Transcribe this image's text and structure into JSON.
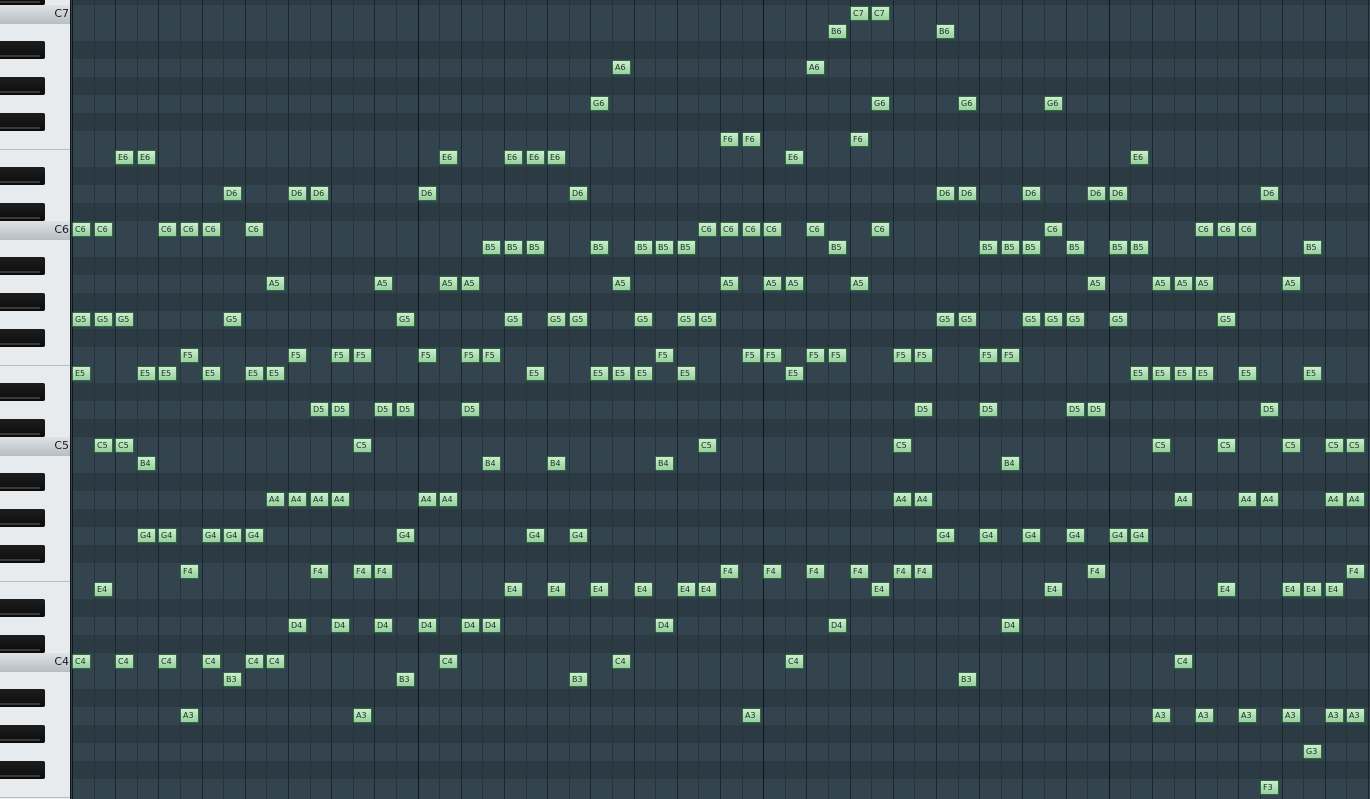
{
  "piano_roll": {
    "octave_labels": {
      "C7": "C7",
      "C6": "C6",
      "C5": "C5",
      "C4": "C4"
    },
    "note_color": "#a9dcb0",
    "grid_color": "#34444e",
    "notes": [
      {
        "pitch": "C7",
        "step": 36
      },
      {
        "pitch": "C7",
        "step": 37
      },
      {
        "pitch": "B6",
        "step": 35
      },
      {
        "pitch": "B6",
        "step": 40
      },
      {
        "pitch": "A6",
        "step": 25
      },
      {
        "pitch": "A6",
        "step": 34
      },
      {
        "pitch": "G6",
        "step": 24
      },
      {
        "pitch": "G6",
        "step": 37
      },
      {
        "pitch": "G6",
        "step": 41
      },
      {
        "pitch": "G6",
        "step": 45
      },
      {
        "pitch": "F6",
        "step": 30
      },
      {
        "pitch": "F6",
        "step": 31
      },
      {
        "pitch": "F6",
        "step": 36
      },
      {
        "pitch": "E6",
        "step": 2
      },
      {
        "pitch": "E6",
        "step": 3
      },
      {
        "pitch": "E6",
        "step": 17
      },
      {
        "pitch": "E6",
        "step": 20
      },
      {
        "pitch": "E6",
        "step": 21
      },
      {
        "pitch": "E6",
        "step": 22
      },
      {
        "pitch": "E6",
        "step": 33
      },
      {
        "pitch": "E6",
        "step": 49
      },
      {
        "pitch": "D6",
        "step": 7
      },
      {
        "pitch": "D6",
        "step": 10
      },
      {
        "pitch": "D6",
        "step": 11
      },
      {
        "pitch": "D6",
        "step": 16
      },
      {
        "pitch": "D6",
        "step": 23
      },
      {
        "pitch": "D6",
        "step": 40
      },
      {
        "pitch": "D6",
        "step": 41
      },
      {
        "pitch": "D6",
        "step": 44
      },
      {
        "pitch": "D6",
        "step": 47
      },
      {
        "pitch": "D6",
        "step": 48
      },
      {
        "pitch": "D6",
        "step": 55
      },
      {
        "pitch": "C6",
        "step": 0
      },
      {
        "pitch": "C6",
        "step": 1
      },
      {
        "pitch": "C6",
        "step": 4
      },
      {
        "pitch": "C6",
        "step": 5
      },
      {
        "pitch": "C6",
        "step": 6
      },
      {
        "pitch": "C6",
        "step": 8
      },
      {
        "pitch": "C6",
        "step": 29
      },
      {
        "pitch": "C6",
        "step": 30
      },
      {
        "pitch": "C6",
        "step": 31
      },
      {
        "pitch": "C6",
        "step": 32
      },
      {
        "pitch": "C6",
        "step": 34
      },
      {
        "pitch": "C6",
        "step": 37
      },
      {
        "pitch": "C6",
        "step": 45
      },
      {
        "pitch": "C6",
        "step": 52
      },
      {
        "pitch": "C6",
        "step": 53
      },
      {
        "pitch": "C6",
        "step": 54
      },
      {
        "pitch": "B5",
        "step": 19
      },
      {
        "pitch": "B5",
        "step": 20
      },
      {
        "pitch": "B5",
        "step": 21
      },
      {
        "pitch": "B5",
        "step": 24
      },
      {
        "pitch": "B5",
        "step": 26
      },
      {
        "pitch": "B5",
        "step": 27
      },
      {
        "pitch": "B5",
        "step": 28
      },
      {
        "pitch": "B5",
        "step": 35
      },
      {
        "pitch": "B5",
        "step": 42
      },
      {
        "pitch": "B5",
        "step": 43
      },
      {
        "pitch": "B5",
        "step": 44
      },
      {
        "pitch": "B5",
        "step": 46
      },
      {
        "pitch": "B5",
        "step": 48
      },
      {
        "pitch": "B5",
        "step": 49
      },
      {
        "pitch": "B5",
        "step": 57
      },
      {
        "pitch": "A5",
        "step": 9
      },
      {
        "pitch": "A5",
        "step": 14
      },
      {
        "pitch": "A5",
        "step": 17
      },
      {
        "pitch": "A5",
        "step": 18
      },
      {
        "pitch": "A5",
        "step": 25
      },
      {
        "pitch": "A5",
        "step": 30
      },
      {
        "pitch": "A5",
        "step": 32
      },
      {
        "pitch": "A5",
        "step": 33
      },
      {
        "pitch": "A5",
        "step": 36
      },
      {
        "pitch": "A5",
        "step": 47
      },
      {
        "pitch": "A5",
        "step": 50
      },
      {
        "pitch": "A5",
        "step": 51
      },
      {
        "pitch": "A5",
        "step": 52
      },
      {
        "pitch": "A5",
        "step": 56
      },
      {
        "pitch": "G5",
        "step": 0
      },
      {
        "pitch": "G5",
        "step": 1
      },
      {
        "pitch": "G5",
        "step": 2
      },
      {
        "pitch": "G5",
        "step": 7
      },
      {
        "pitch": "G5",
        "step": 15
      },
      {
        "pitch": "G5",
        "step": 20
      },
      {
        "pitch": "G5",
        "step": 22
      },
      {
        "pitch": "G5",
        "step": 23
      },
      {
        "pitch": "G5",
        "step": 26
      },
      {
        "pitch": "G5",
        "step": 28
      },
      {
        "pitch": "G5",
        "step": 29
      },
      {
        "pitch": "G5",
        "step": 40
      },
      {
        "pitch": "G5",
        "step": 41
      },
      {
        "pitch": "G5",
        "step": 44
      },
      {
        "pitch": "G5",
        "step": 45
      },
      {
        "pitch": "G5",
        "step": 46
      },
      {
        "pitch": "G5",
        "step": 48
      },
      {
        "pitch": "G5",
        "step": 53
      },
      {
        "pitch": "F5",
        "step": 5
      },
      {
        "pitch": "F5",
        "step": 10
      },
      {
        "pitch": "F5",
        "step": 12
      },
      {
        "pitch": "F5",
        "step": 13
      },
      {
        "pitch": "F5",
        "step": 16
      },
      {
        "pitch": "F5",
        "step": 18
      },
      {
        "pitch": "F5",
        "step": 19
      },
      {
        "pitch": "F5",
        "step": 27
      },
      {
        "pitch": "F5",
        "step": 31
      },
      {
        "pitch": "F5",
        "step": 32
      },
      {
        "pitch": "F5",
        "step": 34
      },
      {
        "pitch": "F5",
        "step": 35
      },
      {
        "pitch": "F5",
        "step": 38
      },
      {
        "pitch": "F5",
        "step": 39
      },
      {
        "pitch": "F5",
        "step": 42
      },
      {
        "pitch": "F5",
        "step": 43
      },
      {
        "pitch": "E5",
        "step": 0
      },
      {
        "pitch": "E5",
        "step": 3
      },
      {
        "pitch": "E5",
        "step": 4
      },
      {
        "pitch": "E5",
        "step": 6
      },
      {
        "pitch": "E5",
        "step": 8
      },
      {
        "pitch": "E5",
        "step": 9
      },
      {
        "pitch": "E5",
        "step": 21
      },
      {
        "pitch": "E5",
        "step": 24
      },
      {
        "pitch": "E5",
        "step": 25
      },
      {
        "pitch": "E5",
        "step": 26
      },
      {
        "pitch": "E5",
        "step": 28
      },
      {
        "pitch": "E5",
        "step": 33
      },
      {
        "pitch": "E5",
        "step": 49
      },
      {
        "pitch": "E5",
        "step": 50
      },
      {
        "pitch": "E5",
        "step": 51
      },
      {
        "pitch": "E5",
        "step": 52
      },
      {
        "pitch": "E5",
        "step": 54
      },
      {
        "pitch": "E5",
        "step": 57
      },
      {
        "pitch": "D5",
        "step": 11
      },
      {
        "pitch": "D5",
        "step": 12
      },
      {
        "pitch": "D5",
        "step": 14
      },
      {
        "pitch": "D5",
        "step": 15
      },
      {
        "pitch": "D5",
        "step": 18
      },
      {
        "pitch": "D5",
        "step": 39
      },
      {
        "pitch": "D5",
        "step": 42
      },
      {
        "pitch": "D5",
        "step": 46
      },
      {
        "pitch": "D5",
        "step": 47
      },
      {
        "pitch": "D5",
        "step": 55
      },
      {
        "pitch": "C5",
        "step": 1
      },
      {
        "pitch": "C5",
        "step": 2
      },
      {
        "pitch": "C5",
        "step": 13
      },
      {
        "pitch": "C5",
        "step": 29
      },
      {
        "pitch": "C5",
        "step": 38
      },
      {
        "pitch": "C5",
        "step": 50
      },
      {
        "pitch": "C5",
        "step": 53
      },
      {
        "pitch": "C5",
        "step": 56
      },
      {
        "pitch": "C5",
        "step": 58
      },
      {
        "pitch": "C5",
        "step": 59
      },
      {
        "pitch": "B4",
        "step": 3
      },
      {
        "pitch": "B4",
        "step": 19
      },
      {
        "pitch": "B4",
        "step": 22
      },
      {
        "pitch": "B4",
        "step": 27
      },
      {
        "pitch": "B4",
        "step": 43
      },
      {
        "pitch": "A4",
        "step": 9
      },
      {
        "pitch": "A4",
        "step": 10
      },
      {
        "pitch": "A4",
        "step": 11
      },
      {
        "pitch": "A4",
        "step": 12
      },
      {
        "pitch": "A4",
        "step": 16
      },
      {
        "pitch": "A4",
        "step": 17
      },
      {
        "pitch": "A4",
        "step": 38
      },
      {
        "pitch": "A4",
        "step": 39
      },
      {
        "pitch": "A4",
        "step": 51
      },
      {
        "pitch": "A4",
        "step": 54
      },
      {
        "pitch": "A4",
        "step": 55
      },
      {
        "pitch": "A4",
        "step": 58
      },
      {
        "pitch": "A4",
        "step": 59
      },
      {
        "pitch": "G4",
        "step": 3
      },
      {
        "pitch": "G4",
        "step": 4
      },
      {
        "pitch": "G4",
        "step": 6
      },
      {
        "pitch": "G4",
        "step": 7
      },
      {
        "pitch": "G4",
        "step": 8
      },
      {
        "pitch": "G4",
        "step": 15
      },
      {
        "pitch": "G4",
        "step": 21
      },
      {
        "pitch": "G4",
        "step": 23
      },
      {
        "pitch": "G4",
        "step": 40
      },
      {
        "pitch": "G4",
        "step": 42
      },
      {
        "pitch": "G4",
        "step": 44
      },
      {
        "pitch": "G4",
        "step": 46
      },
      {
        "pitch": "G4",
        "step": 48
      },
      {
        "pitch": "G4",
        "step": 49
      },
      {
        "pitch": "F4",
        "step": 5
      },
      {
        "pitch": "F4",
        "step": 11
      },
      {
        "pitch": "F4",
        "step": 13
      },
      {
        "pitch": "F4",
        "step": 14
      },
      {
        "pitch": "F4",
        "step": 30
      },
      {
        "pitch": "F4",
        "step": 32
      },
      {
        "pitch": "F4",
        "step": 34
      },
      {
        "pitch": "F4",
        "step": 36
      },
      {
        "pitch": "F4",
        "step": 38
      },
      {
        "pitch": "F4",
        "step": 39
      },
      {
        "pitch": "F4",
        "step": 47
      },
      {
        "pitch": "F4",
        "step": 59
      },
      {
        "pitch": "E4",
        "step": 1
      },
      {
        "pitch": "E4",
        "step": 20
      },
      {
        "pitch": "E4",
        "step": 22
      },
      {
        "pitch": "E4",
        "step": 24
      },
      {
        "pitch": "E4",
        "step": 26
      },
      {
        "pitch": "E4",
        "step": 28
      },
      {
        "pitch": "E4",
        "step": 29
      },
      {
        "pitch": "E4",
        "step": 37
      },
      {
        "pitch": "E4",
        "step": 45
      },
      {
        "pitch": "E4",
        "step": 53
      },
      {
        "pitch": "E4",
        "step": 56
      },
      {
        "pitch": "E4",
        "step": 57
      },
      {
        "pitch": "E4",
        "step": 58
      },
      {
        "pitch": "D4",
        "step": 10
      },
      {
        "pitch": "D4",
        "step": 12
      },
      {
        "pitch": "D4",
        "step": 14
      },
      {
        "pitch": "D4",
        "step": 16
      },
      {
        "pitch": "D4",
        "step": 18
      },
      {
        "pitch": "D4",
        "step": 19
      },
      {
        "pitch": "D4",
        "step": 27
      },
      {
        "pitch": "D4",
        "step": 35
      },
      {
        "pitch": "D4",
        "step": 43
      },
      {
        "pitch": "C4",
        "step": 0
      },
      {
        "pitch": "C4",
        "step": 2
      },
      {
        "pitch": "C4",
        "step": 4
      },
      {
        "pitch": "C4",
        "step": 6
      },
      {
        "pitch": "C4",
        "step": 8
      },
      {
        "pitch": "C4",
        "step": 9
      },
      {
        "pitch": "C4",
        "step": 17
      },
      {
        "pitch": "C4",
        "step": 25
      },
      {
        "pitch": "C4",
        "step": 33
      },
      {
        "pitch": "C4",
        "step": 51
      },
      {
        "pitch": "B3",
        "step": 7
      },
      {
        "pitch": "B3",
        "step": 15
      },
      {
        "pitch": "B3",
        "step": 23
      },
      {
        "pitch": "B3",
        "step": 41
      },
      {
        "pitch": "A3",
        "step": 5
      },
      {
        "pitch": "A3",
        "step": 13
      },
      {
        "pitch": "A3",
        "step": 31
      },
      {
        "pitch": "A3",
        "step": 50
      },
      {
        "pitch": "A3",
        "step": 52
      },
      {
        "pitch": "A3",
        "step": 54
      },
      {
        "pitch": "A3",
        "step": 56
      },
      {
        "pitch": "A3",
        "step": 58
      },
      {
        "pitch": "A3",
        "step": 59
      },
      {
        "pitch": "G3",
        "step": 57
      },
      {
        "pitch": "F3",
        "step": 55
      }
    ]
  }
}
